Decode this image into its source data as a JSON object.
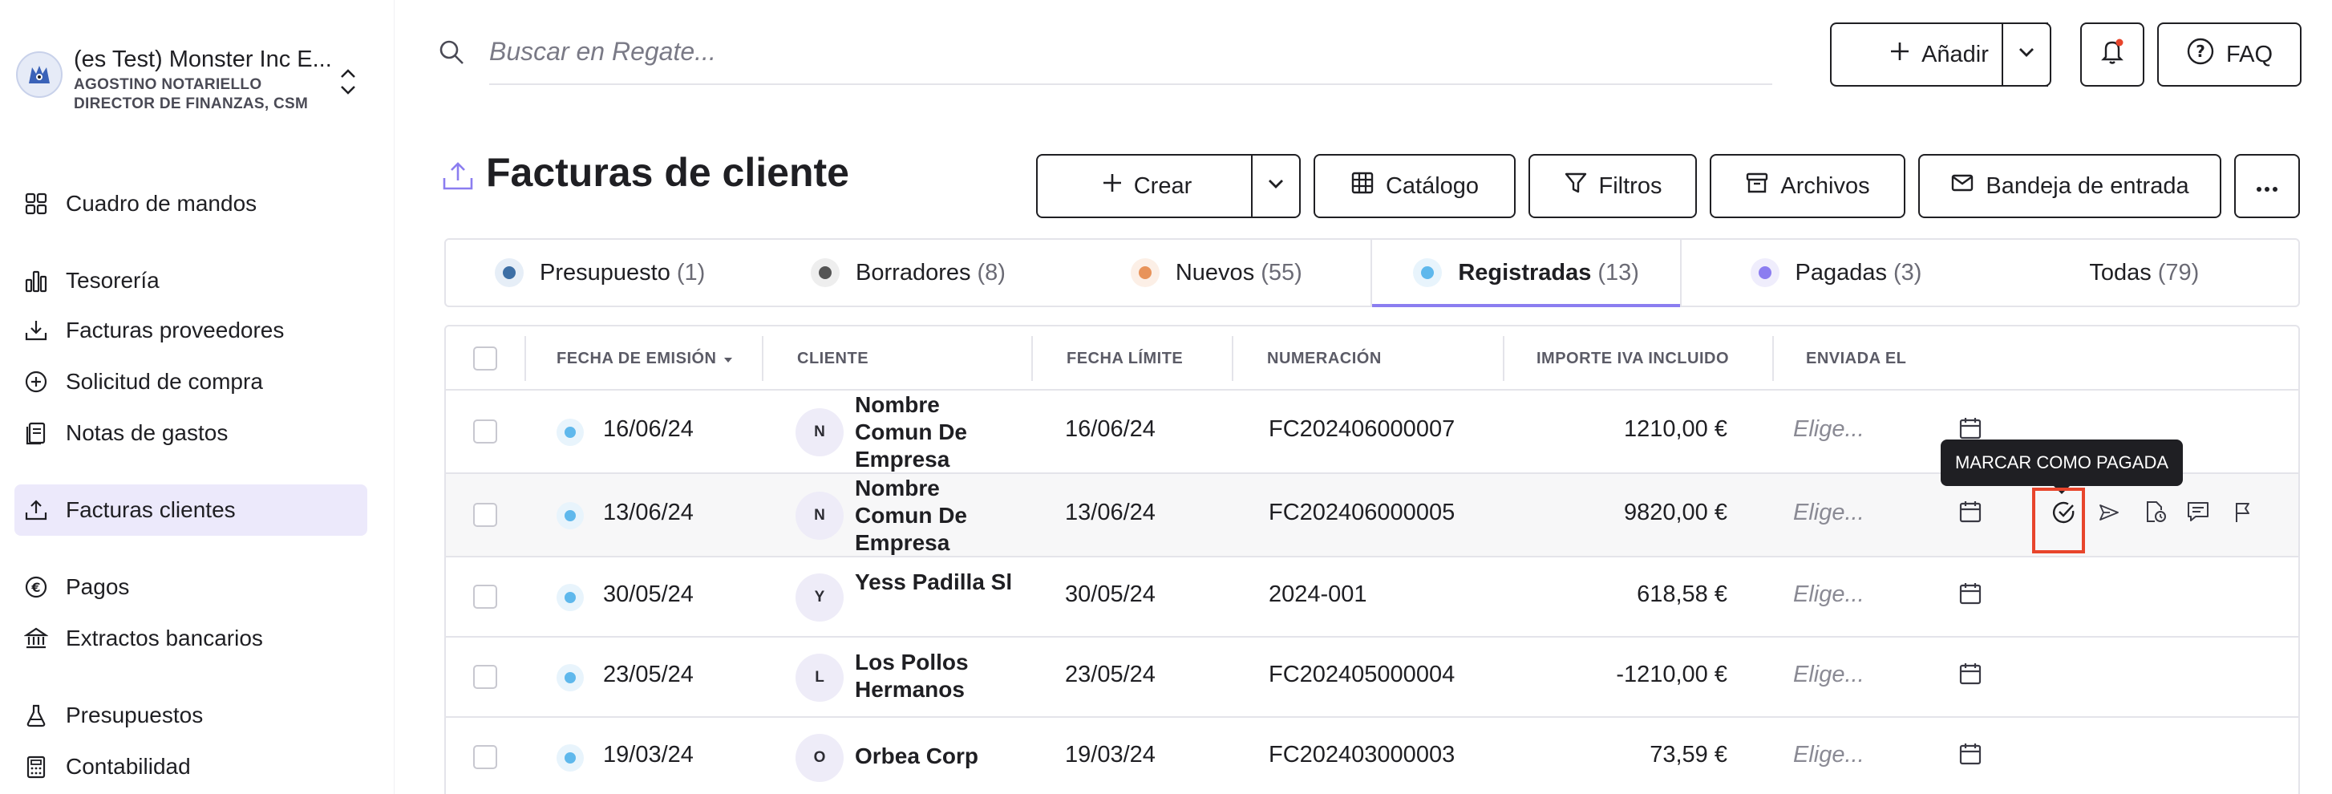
{
  "company": {
    "name": "(es Test) Monster Inc E...",
    "user_name": "AGOSTINO NOTARIELLO",
    "user_role": "DIRECTOR DE FINANZAS, CSM"
  },
  "sidebar": {
    "items": [
      {
        "label": "Cuadro de mandos",
        "icon": "dashboard-icon"
      },
      {
        "label": "Tesorería",
        "icon": "bar-chart-icon"
      },
      {
        "label": "Facturas proveedores",
        "icon": "download-tray-icon"
      },
      {
        "label": "Solicitud de compra",
        "icon": "plus-circle-icon"
      },
      {
        "label": "Notas de gastos",
        "icon": "receipt-icon"
      },
      {
        "label": "Facturas clientes",
        "icon": "upload-tray-icon",
        "active": true
      },
      {
        "label": "Pagos",
        "icon": "euro-circle-icon"
      },
      {
        "label": "Extractos bancarios",
        "icon": "bank-icon"
      },
      {
        "label": "Presupuestos",
        "icon": "flask-icon"
      },
      {
        "label": "Contabilidad",
        "icon": "calculator-icon"
      }
    ]
  },
  "topbar": {
    "search_placeholder": "Buscar en Regate...",
    "add_label": "Añadir",
    "faq_label": "FAQ"
  },
  "page": {
    "title": "Facturas de cliente",
    "toolbar": {
      "create_label": "Crear",
      "catalog_label": "Catálogo",
      "filters_label": "Filtros",
      "archive_label": "Archivos",
      "inbox_label": "Bandeja de entrada"
    }
  },
  "tabs": [
    {
      "label": "Presupuesto",
      "count": "(1)",
      "color": "#3d6fa5",
      "bg": "#e6eef7"
    },
    {
      "label": "Borradores",
      "count": "(8)",
      "color": "#555555",
      "bg": "#eeeeee"
    },
    {
      "label": "Nuevos",
      "count": "(55)",
      "color": "#e8935a",
      "bg": "#fcefe6"
    },
    {
      "label": "Registradas",
      "count": "(13)",
      "color": "#5fb8ec",
      "bg": "#e8f4fc",
      "active": true
    },
    {
      "label": "Pagadas",
      "count": "(3)",
      "color": "#8b7df0",
      "bg": "#efedfc"
    },
    {
      "label": "Todas",
      "count": "(79)"
    }
  ],
  "table": {
    "headers": [
      "FECHA DE EMISIÓN",
      "CLIENTE",
      "FECHA LÍMITE",
      "NUMERACIÓN",
      "IMPORTE IVA INCLUIDO",
      "ENVIADA EL"
    ],
    "rows": [
      {
        "date": "16/06/24",
        "initial": "N",
        "client": "Nombre Comun De Empresa",
        "due": "16/06/24",
        "number": "FC202406000007",
        "amount": "1210,00 €",
        "sent": "Elige..."
      },
      {
        "date": "13/06/24",
        "initial": "N",
        "client": "Nombre Comun De Empresa",
        "due": "13/06/24",
        "number": "FC202406000005",
        "amount": "9820,00 €",
        "sent": "Elige..."
      },
      {
        "date": "30/05/24",
        "initial": "Y",
        "client": "Yess Padilla Sl",
        "due": "30/05/24",
        "number": "2024-001",
        "amount": "618,58 €",
        "sent": "Elige..."
      },
      {
        "date": "23/05/24",
        "initial": "L",
        "client": "Los Pollos Hermanos",
        "due": "23/05/24",
        "number": "FC202405000004",
        "amount": "-1210,00 €",
        "sent": "Elige..."
      },
      {
        "date": "19/03/24",
        "initial": "O",
        "client": "Orbea Corp",
        "due": "19/03/24",
        "number": "FC202403000003",
        "amount": "73,59 €",
        "sent": "Elige..."
      }
    ]
  },
  "tooltip": "MARCAR COMO PAGADA"
}
